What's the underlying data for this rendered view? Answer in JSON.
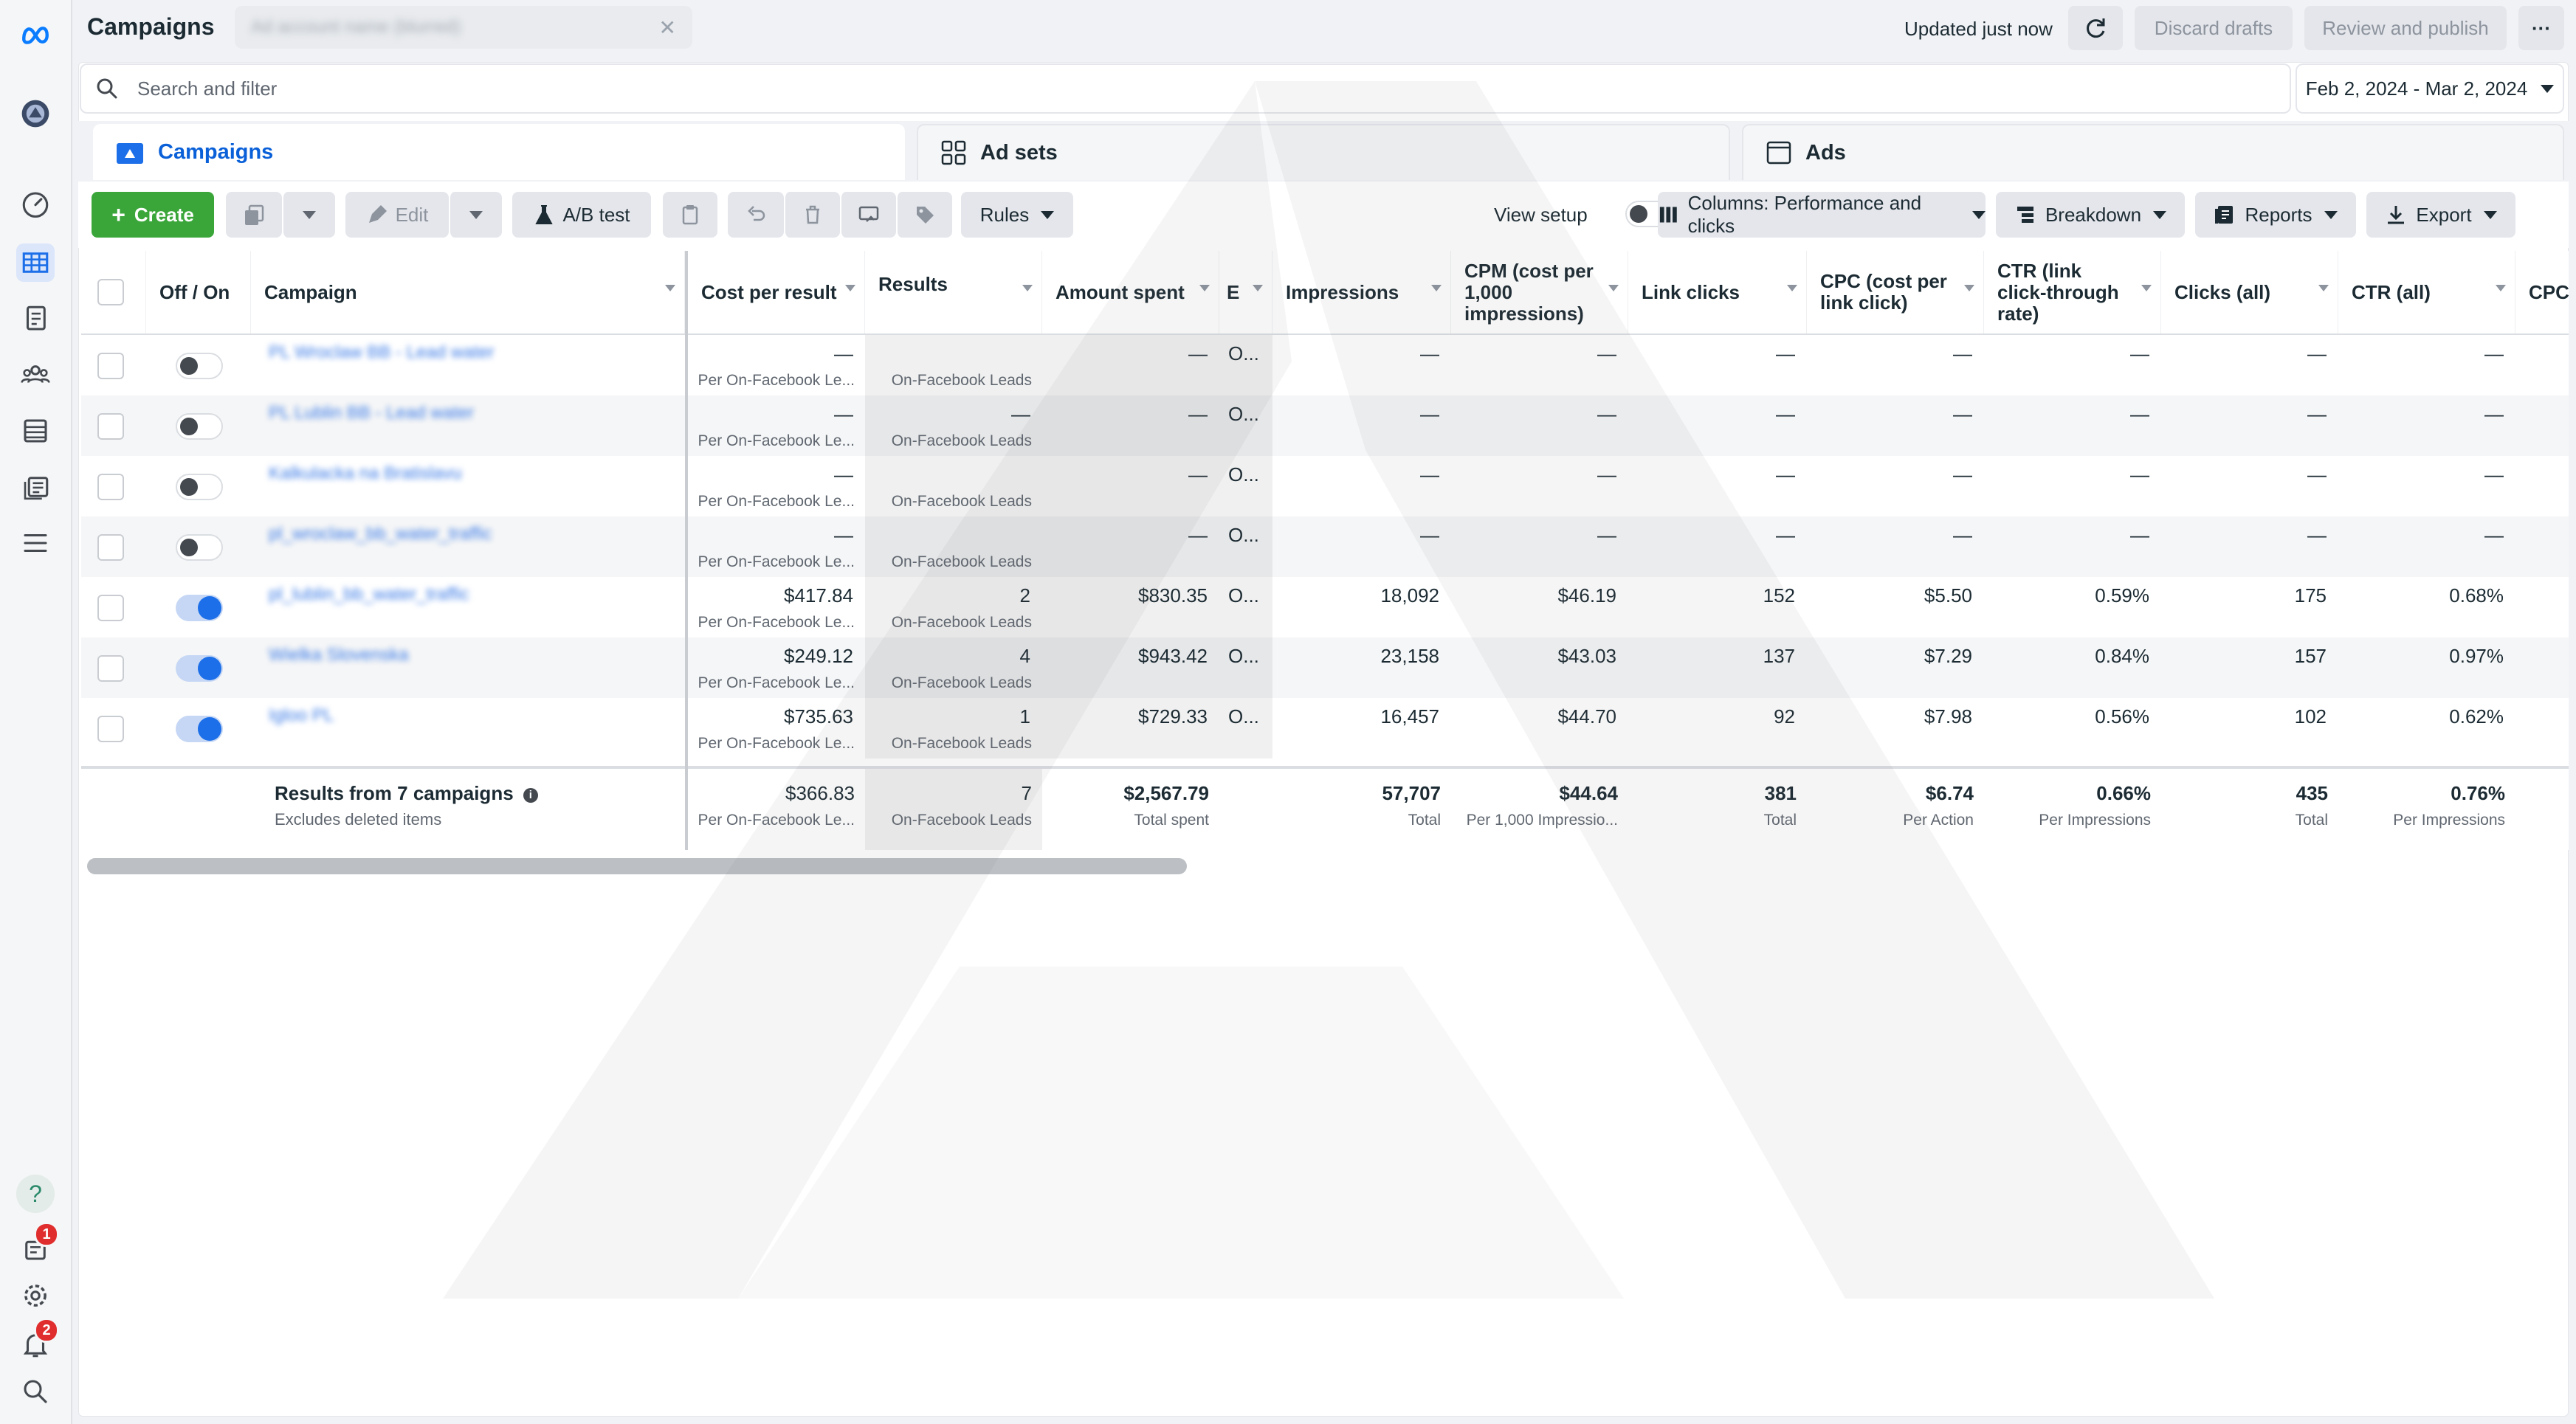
{
  "app": {
    "title": "Campaigns",
    "account_placeholder": "Ad account name (blurred)"
  },
  "header": {
    "updated": "Updated just now",
    "discard": "Discard drafts",
    "review": "Review and publish",
    "more": "···"
  },
  "search": {
    "placeholder": "Search and filter"
  },
  "date_range": "Feb 2, 2024 -  Mar 2, 2024",
  "tabs": [
    {
      "label": "Campaigns"
    },
    {
      "label": "Ad sets"
    },
    {
      "label": "Ads"
    }
  ],
  "toolbar": {
    "create": "Create",
    "edit": "Edit",
    "ab_test": "A/B test",
    "rules": "Rules",
    "view_setup": "View setup",
    "columns": "Columns: Performance and clicks",
    "breakdown": "Breakdown",
    "reports": "Reports",
    "export": "Export"
  },
  "columns": [
    "Off / On",
    "Campaign",
    "Cost per result",
    "Results",
    "Amount spent",
    "E",
    "Impressions",
    "CPM (cost per 1,000 impressions)",
    "Link clicks",
    "CPC (cost per link click)",
    "CTR (link click-through rate)",
    "Clicks (all)",
    "CTR (all)",
    "CPC"
  ],
  "rows": [
    {
      "on": false,
      "name": "PL Wroclaw BB - Lead water",
      "cpr": "—",
      "cpr_sub": "Per On-Facebook Le...",
      "results": "",
      "results_sub": "On-Facebook Leads",
      "spent": "—",
      "e": "O...",
      "impressions": "—",
      "cpm": "—",
      "link_clicks": "—",
      "cpc": "—",
      "ctr": "—",
      "clicks_all": "—",
      "ctr_all": "—"
    },
    {
      "on": false,
      "name": "PL Lublin BB - Lead water",
      "cpr": "—",
      "cpr_sub": "Per On-Facebook Le...",
      "results": "—",
      "results_sub": "On-Facebook Leads",
      "spent": "—",
      "e": "O...",
      "impressions": "—",
      "cpm": "—",
      "link_clicks": "—",
      "cpc": "—",
      "ctr": "—",
      "clicks_all": "—",
      "ctr_all": "—"
    },
    {
      "on": false,
      "name": "Kalkulacka na Bratislavu",
      "cpr": "—",
      "cpr_sub": "Per On-Facebook Le...",
      "results": "",
      "results_sub": "On-Facebook Leads",
      "spent": "—",
      "e": "O...",
      "impressions": "—",
      "cpm": "—",
      "link_clicks": "—",
      "cpc": "—",
      "ctr": "—",
      "clicks_all": "—",
      "ctr_all": "—"
    },
    {
      "on": false,
      "name": "pl_wroclaw_bb_water_traffic",
      "cpr": "—",
      "cpr_sub": "Per On-Facebook Le...",
      "results": "",
      "results_sub": "On-Facebook Leads",
      "spent": "—",
      "e": "O...",
      "impressions": "—",
      "cpm": "—",
      "link_clicks": "—",
      "cpc": "—",
      "ctr": "—",
      "clicks_all": "—",
      "ctr_all": "—"
    },
    {
      "on": true,
      "name": "pl_lublin_bb_water_traffic",
      "cpr": "$417.84",
      "cpr_sub": "Per On-Facebook Le...",
      "results": "2",
      "results_sub": "On-Facebook Leads",
      "spent": "$830.35",
      "e": "O...",
      "impressions": "18,092",
      "cpm": "$46.19",
      "link_clicks": "152",
      "cpc": "$5.50",
      "ctr": "0.59%",
      "clicks_all": "175",
      "ctr_all": "0.68%"
    },
    {
      "on": true,
      "name": "Wielka Slovenska",
      "cpr": "$249.12",
      "cpr_sub": "Per On-Facebook Le...",
      "results": "4",
      "results_sub": "On-Facebook Leads",
      "spent": "$943.42",
      "e": "O...",
      "impressions": "23,158",
      "cpm": "$43.03",
      "link_clicks": "137",
      "cpc": "$7.29",
      "ctr": "0.84%",
      "clicks_all": "157",
      "ctr_all": "0.97%"
    },
    {
      "on": true,
      "name": "Igloo PL",
      "cpr": "$735.63",
      "cpr_sub": "Per On-Facebook Le...",
      "results": "1",
      "results_sub": "On-Facebook Leads",
      "spent": "$729.33",
      "e": "O...",
      "impressions": "16,457",
      "cpm": "$44.70",
      "link_clicks": "92",
      "cpc": "$7.98",
      "ctr": "0.56%",
      "clicks_all": "102",
      "ctr_all": "0.62%"
    }
  ],
  "totals": {
    "label": "Results from 7 campaigns",
    "sublabel": "Excludes deleted items",
    "cpr": "$366.83",
    "cpr_sub": "Per On-Facebook Le...",
    "results": "7",
    "results_sub": "On-Facebook Leads",
    "spent": "$2,567.79",
    "spent_sub": "Total spent",
    "impressions": "57,707",
    "impressions_sub": "Total",
    "cpm": "$44.64",
    "cpm_sub": "Per 1,000 Impressio...",
    "link_clicks": "381",
    "link_clicks_sub": "Total",
    "cpc": "$6.74",
    "cpc_sub": "Per Action",
    "ctr": "0.66%",
    "ctr_sub": "Per Impressions",
    "clicks_all": "435",
    "clicks_all_sub": "Total",
    "ctr_all": "0.76%",
    "ctr_all_sub": "Per Impressions"
  },
  "sidebar": {
    "notif_badge": "1",
    "alerts_badge": "2",
    "help": "?"
  },
  "colors": {
    "accent": "#1c6fe8",
    "create": "#3aa63a",
    "badge": "#e02d2d"
  }
}
